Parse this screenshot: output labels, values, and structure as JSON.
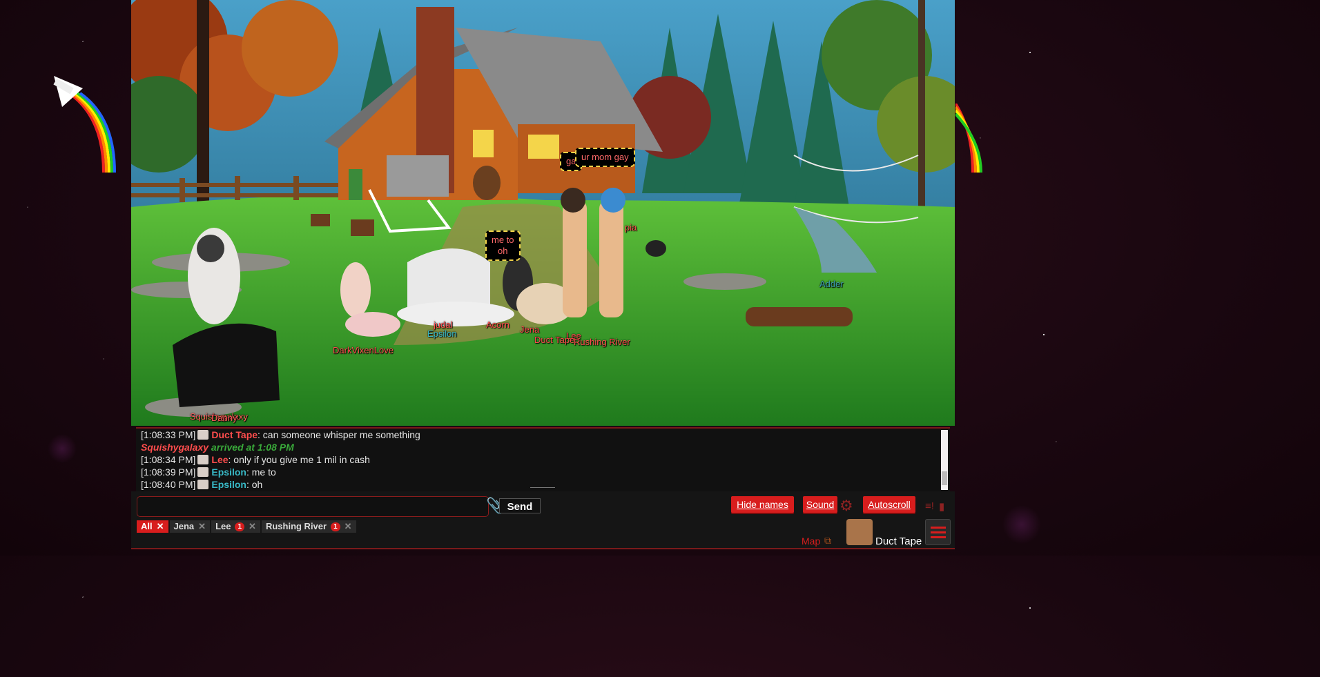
{
  "scene": {
    "usernames": [
      {
        "text": "Squishygalaxy",
        "color": "#ff5a5a"
      },
      {
        "text": "Danny",
        "color": "#ff5a5a"
      },
      {
        "text": "DarkVixenLove",
        "color": "#ff4d4d"
      },
      {
        "text": "judal",
        "color": "#ff4d4d"
      },
      {
        "text": "Epsilon",
        "color": "#38b9c7"
      },
      {
        "text": "Acorn",
        "color": "#ff4d4d"
      },
      {
        "text": "Jena",
        "color": "#ff4d4d"
      },
      {
        "text": "Lee",
        "color": "#ff4d4d"
      },
      {
        "text": "Duct Tape",
        "color": "#ff4d4d"
      },
      {
        "text": "Rushing River",
        "color": "#ff4d4d"
      },
      {
        "text": "pia",
        "color": "#ff4d4d"
      },
      {
        "text": "Adder",
        "color": "#3a9aa8"
      }
    ],
    "bubbles": [
      {
        "text": "ga"
      },
      {
        "text": "ur mom gay"
      },
      {
        "text": "me to\noh"
      }
    ]
  },
  "chat": {
    "lines": [
      {
        "type": "msg",
        "time": "[1:08:33 PM]",
        "name": "Duct Tape",
        "name_color": "red",
        "text": ": can someone whisper me something"
      },
      {
        "type": "arrive",
        "name": "Squishygalaxy",
        "text": " arrived at 1:08 PM"
      },
      {
        "type": "msg",
        "time": "[1:08:34 PM]",
        "name": "Lee",
        "name_color": "red",
        "text": ": only if you give me 1 mil in cash"
      },
      {
        "type": "msg",
        "time": "[1:08:39 PM]",
        "name": "Epsilon",
        "name_color": "teal",
        "text": ": me to"
      },
      {
        "type": "msg",
        "time": "[1:08:40 PM]",
        "name": "Epsilon",
        "name_color": "teal",
        "text": ": oh"
      }
    ]
  },
  "input": {
    "value": "",
    "placeholder": ""
  },
  "buttons": {
    "send": "Send",
    "hide_names": "Hide names",
    "sound": "Sound",
    "autoscroll": "Autoscroll"
  },
  "tabs": [
    {
      "label": "All",
      "badge": "",
      "active": true
    },
    {
      "label": "Jena",
      "badge": "",
      "active": false
    },
    {
      "label": "Lee",
      "badge": "1",
      "active": false
    },
    {
      "label": "Rushing River",
      "badge": "1",
      "active": false
    }
  ],
  "footer": {
    "map_label": "Map",
    "username": "Duct Tape"
  },
  "colors": {
    "accent": "#d81d1d",
    "teal": "#38b9c7",
    "green": "#39a93a"
  }
}
